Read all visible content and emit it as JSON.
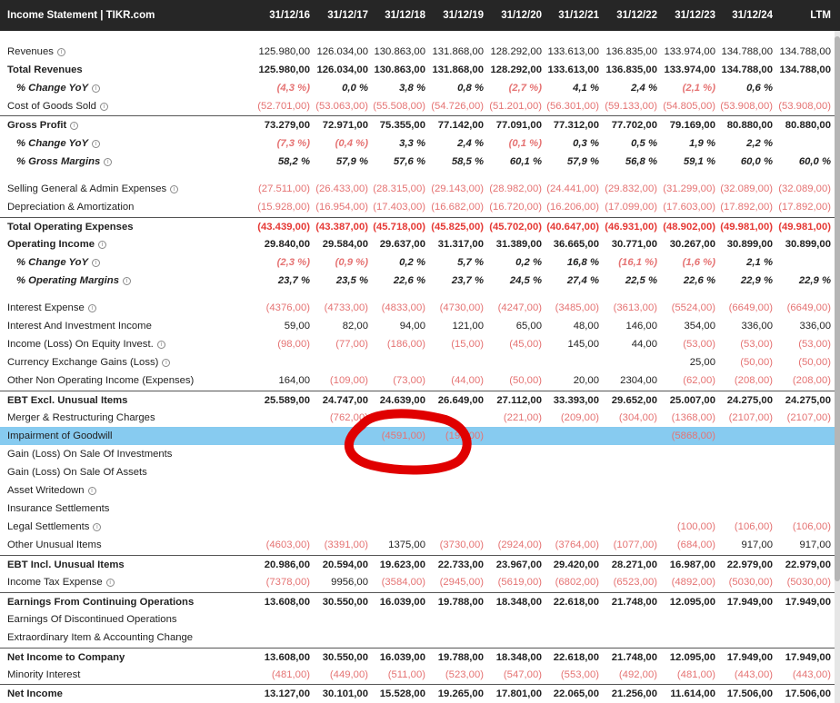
{
  "header": {
    "title": "Income Statement | TIKR.com",
    "periods": [
      "31/12/16",
      "31/12/17",
      "31/12/18",
      "31/12/19",
      "31/12/20",
      "31/12/21",
      "31/12/22",
      "31/12/23",
      "31/12/24",
      "LTM"
    ]
  },
  "rows": [
    {
      "label": "Revenues",
      "style": "normal",
      "info": true,
      "values": [
        "125.980,00",
        "126.034,00",
        "130.863,00",
        "131.868,00",
        "128.292,00",
        "133.613,00",
        "136.835,00",
        "133.974,00",
        "134.788,00",
        "134.788,00"
      ]
    },
    {
      "label": "Total Revenues",
      "style": "bold",
      "info": false,
      "values": [
        "125.980,00",
        "126.034,00",
        "130.863,00",
        "131.868,00",
        "128.292,00",
        "133.613,00",
        "136.835,00",
        "133.974,00",
        "134.788,00",
        "134.788,00"
      ]
    },
    {
      "label": "% Change YoY",
      "style": "italic",
      "info": true,
      "values": [
        "(4,3 %)",
        "0,0 %",
        "3,8 %",
        "0,8 %",
        "(2,7 %)",
        "4,1 %",
        "2,4 %",
        "(2,1 %)",
        "0,6 %",
        ""
      ]
    },
    {
      "label": "Cost of Goods Sold",
      "style": "normal",
      "info": true,
      "values": [
        "(52.701,00)",
        "(53.063,00)",
        "(55.508,00)",
        "(54.726,00)",
        "(51.201,00)",
        "(56.301,00)",
        "(59.133,00)",
        "(54.805,00)",
        "(53.908,00)",
        "(53.908,00)"
      ]
    },
    {
      "label": "Gross Profit",
      "style": "bold-line",
      "info": true,
      "values": [
        "73.279,00",
        "72.971,00",
        "75.355,00",
        "77.142,00",
        "77.091,00",
        "77.312,00",
        "77.702,00",
        "79.169,00",
        "80.880,00",
        "80.880,00"
      ]
    },
    {
      "label": "% Change YoY",
      "style": "italic",
      "info": true,
      "values": [
        "(7,3 %)",
        "(0,4 %)",
        "3,3 %",
        "2,4 %",
        "(0,1 %)",
        "0,3 %",
        "0,5 %",
        "1,9 %",
        "2,2 %",
        ""
      ]
    },
    {
      "label": "% Gross Margins",
      "style": "italic",
      "info": true,
      "values": [
        "58,2 %",
        "57,9 %",
        "57,6 %",
        "58,5 %",
        "60,1 %",
        "57,9 %",
        "56,8 %",
        "59,1 %",
        "60,0 %",
        "60,0 %"
      ]
    },
    {
      "label": "",
      "style": "spacer",
      "info": false,
      "values": []
    },
    {
      "label": "Selling General & Admin Expenses",
      "style": "normal",
      "info": true,
      "values": [
        "(27.511,00)",
        "(26.433,00)",
        "(28.315,00)",
        "(29.143,00)",
        "(28.982,00)",
        "(24.441,00)",
        "(29.832,00)",
        "(31.299,00)",
        "(32.089,00)",
        "(32.089,00)"
      ]
    },
    {
      "label": "Depreciation & Amortization",
      "style": "normal",
      "info": false,
      "values": [
        "(15.928,00)",
        "(16.954,00)",
        "(17.403,00)",
        "(16.682,00)",
        "(16.720,00)",
        "(16.206,00)",
        "(17.099,00)",
        "(17.603,00)",
        "(17.892,00)",
        "(17.892,00)"
      ]
    },
    {
      "label": "Total Operating Expenses",
      "style": "bold-line",
      "info": false,
      "values": [
        "(43.439,00)",
        "(43.387,00)",
        "(45.718,00)",
        "(45.825,00)",
        "(45.702,00)",
        "(40.647,00)",
        "(46.931,00)",
        "(48.902,00)",
        "(49.981,00)",
        "(49.981,00)"
      ]
    },
    {
      "label": "Operating Income",
      "style": "bold",
      "info": true,
      "values": [
        "29.840,00",
        "29.584,00",
        "29.637,00",
        "31.317,00",
        "31.389,00",
        "36.665,00",
        "30.771,00",
        "30.267,00",
        "30.899,00",
        "30.899,00"
      ]
    },
    {
      "label": "% Change YoY",
      "style": "italic",
      "info": true,
      "values": [
        "(2,3 %)",
        "(0,9 %)",
        "0,2 %",
        "5,7 %",
        "0,2 %",
        "16,8 %",
        "(16,1 %)",
        "(1,6 %)",
        "2,1 %",
        ""
      ]
    },
    {
      "label": "% Operating Margins",
      "style": "italic",
      "info": true,
      "values": [
        "23,7 %",
        "23,5 %",
        "22,6 %",
        "23,7 %",
        "24,5 %",
        "27,4 %",
        "22,5 %",
        "22,6 %",
        "22,9 %",
        "22,9 %"
      ]
    },
    {
      "label": "",
      "style": "spacer",
      "info": false,
      "values": []
    },
    {
      "label": "Interest Expense",
      "style": "normal",
      "info": true,
      "values": [
        "(4376,00)",
        "(4733,00)",
        "(4833,00)",
        "(4730,00)",
        "(4247,00)",
        "(3485,00)",
        "(3613,00)",
        "(5524,00)",
        "(6649,00)",
        "(6649,00)"
      ]
    },
    {
      "label": "Interest And Investment Income",
      "style": "normal",
      "info": false,
      "values": [
        "59,00",
        "82,00",
        "94,00",
        "121,00",
        "65,00",
        "48,00",
        "146,00",
        "354,00",
        "336,00",
        "336,00"
      ]
    },
    {
      "label": "Income (Loss) On Equity Invest.",
      "style": "normal",
      "info": true,
      "values": [
        "(98,00)",
        "(77,00)",
        "(186,00)",
        "(15,00)",
        "(45,00)",
        "145,00",
        "44,00",
        "(53,00)",
        "(53,00)",
        "(53,00)"
      ]
    },
    {
      "label": "Currency Exchange Gains (Loss)",
      "style": "normal",
      "info": true,
      "values": [
        "",
        "",
        "",
        "",
        "",
        "",
        "",
        "25,00",
        "(50,00)",
        "(50,00)"
      ]
    },
    {
      "label": "Other Non Operating Income (Expenses)",
      "style": "normal",
      "info": false,
      "values": [
        "164,00",
        "(109,00)",
        "(73,00)",
        "(44,00)",
        "(50,00)",
        "20,00",
        "2304,00",
        "(62,00)",
        "(208,00)",
        "(208,00)"
      ]
    },
    {
      "label": "EBT Excl. Unusual Items",
      "style": "bold-line",
      "info": false,
      "values": [
        "25.589,00",
        "24.747,00",
        "24.639,00",
        "26.649,00",
        "27.112,00",
        "33.393,00",
        "29.652,00",
        "25.007,00",
        "24.275,00",
        "24.275,00"
      ]
    },
    {
      "label": "Merger & Restructuring Charges",
      "style": "normal",
      "info": false,
      "values": [
        "",
        "(762,00)",
        "",
        "",
        "(221,00)",
        "(209,00)",
        "(304,00)",
        "(1368,00)",
        "(2107,00)",
        "(2107,00)"
      ]
    },
    {
      "label": "Impairment of Goodwill",
      "style": "highlight",
      "info": false,
      "values": [
        "",
        "",
        "(4591,00)",
        "(193,00)",
        "",
        "",
        "",
        "(5868,00)",
        "",
        ""
      ]
    },
    {
      "label": "Gain (Loss) On Sale Of Investments",
      "style": "normal",
      "info": false,
      "values": [
        "",
        "",
        "",
        "",
        "",
        "",
        "",
        "",
        "",
        ""
      ]
    },
    {
      "label": "Gain (Loss) On Sale Of Assets",
      "style": "normal",
      "info": false,
      "values": [
        "",
        "",
        "",
        "",
        "",
        "",
        "",
        "",
        "",
        ""
      ]
    },
    {
      "label": "Asset Writedown",
      "style": "normal",
      "info": true,
      "values": [
        "",
        "",
        "",
        "",
        "",
        "",
        "",
        "",
        "",
        ""
      ]
    },
    {
      "label": "Insurance Settlements",
      "style": "normal",
      "info": false,
      "values": [
        "",
        "",
        "",
        "",
        "",
        "",
        "",
        "",
        "",
        ""
      ]
    },
    {
      "label": "Legal Settlements",
      "style": "normal",
      "info": true,
      "values": [
        "",
        "",
        "",
        "",
        "",
        "",
        "",
        "(100,00)",
        "(106,00)",
        "(106,00)"
      ]
    },
    {
      "label": "Other Unusual Items",
      "style": "normal",
      "info": false,
      "values": [
        "(4603,00)",
        "(3391,00)",
        "1375,00",
        "(3730,00)",
        "(2924,00)",
        "(3764,00)",
        "(1077,00)",
        "(684,00)",
        "917,00",
        "917,00"
      ]
    },
    {
      "label": "EBT Incl. Unusual Items",
      "style": "bold-line",
      "info": false,
      "values": [
        "20.986,00",
        "20.594,00",
        "19.623,00",
        "22.733,00",
        "23.967,00",
        "29.420,00",
        "28.271,00",
        "16.987,00",
        "22.979,00",
        "22.979,00"
      ]
    },
    {
      "label": "Income Tax Expense",
      "style": "normal",
      "info": true,
      "values": [
        "(7378,00)",
        "9956,00",
        "(3584,00)",
        "(2945,00)",
        "(5619,00)",
        "(6802,00)",
        "(6523,00)",
        "(4892,00)",
        "(5030,00)",
        "(5030,00)"
      ]
    },
    {
      "label": "Earnings From Continuing Operations",
      "style": "bold-line",
      "info": false,
      "values": [
        "13.608,00",
        "30.550,00",
        "16.039,00",
        "19.788,00",
        "18.348,00",
        "22.618,00",
        "21.748,00",
        "12.095,00",
        "17.949,00",
        "17.949,00"
      ]
    },
    {
      "label": "Earnings Of Discontinued Operations",
      "style": "normal",
      "info": false,
      "values": [
        "",
        "",
        "",
        "",
        "",
        "",
        "",
        "",
        "",
        ""
      ]
    },
    {
      "label": "Extraordinary Item & Accounting Change",
      "style": "normal",
      "info": false,
      "values": [
        "",
        "",
        "",
        "",
        "",
        "",
        "",
        "",
        "",
        ""
      ]
    },
    {
      "label": "Net Income to Company",
      "style": "bold-line",
      "info": false,
      "values": [
        "13.608,00",
        "30.550,00",
        "16.039,00",
        "19.788,00",
        "18.348,00",
        "22.618,00",
        "21.748,00",
        "12.095,00",
        "17.949,00",
        "17.949,00"
      ]
    },
    {
      "label": "Minority Interest",
      "style": "normal",
      "info": false,
      "values": [
        "(481,00)",
        "(449,00)",
        "(511,00)",
        "(523,00)",
        "(547,00)",
        "(553,00)",
        "(492,00)",
        "(481,00)",
        "(443,00)",
        "(443,00)"
      ]
    },
    {
      "label": "Net Income",
      "style": "bold-line",
      "info": false,
      "values": [
        "13.127,00",
        "30.101,00",
        "15.528,00",
        "19.265,00",
        "17.801,00",
        "22.065,00",
        "21.256,00",
        "11.614,00",
        "17.506,00",
        "17.506,00"
      ]
    }
  ],
  "annotation": {
    "shape": "hand-drawn-circle",
    "color": "#e00000"
  },
  "colors": {
    "header_bg": "#262626",
    "negative": "#e53935",
    "highlight": "#87cbf0"
  }
}
